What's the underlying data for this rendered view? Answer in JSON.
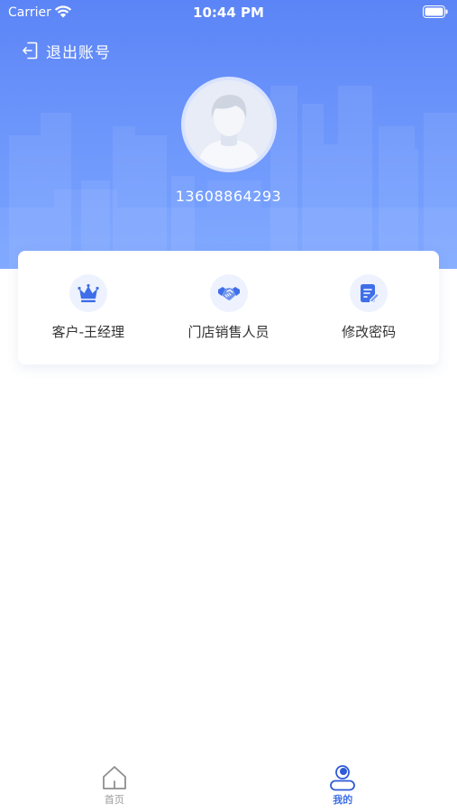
{
  "status_bar": {
    "carrier": "Carrier",
    "time": "10:44 PM"
  },
  "header": {
    "logout_label": "退出账号"
  },
  "profile": {
    "phone": "13608864293"
  },
  "menu": [
    {
      "label": "客户-王经理",
      "icon": "crown-icon"
    },
    {
      "label": "门店销售人员",
      "icon": "handshake-icon"
    },
    {
      "label": "修改密码",
      "icon": "edit-document-icon"
    }
  ],
  "tabbar": [
    {
      "label": "首页",
      "icon": "home-icon",
      "active": false
    },
    {
      "label": "我的",
      "icon": "user-icon",
      "active": true
    }
  ],
  "colors": {
    "header_top": "#5b84f6",
    "header_bottom": "#7aa5ff",
    "accent": "#3f6fe8",
    "icon_bg": "#edf2fe",
    "text": "#333333",
    "tab_inactive": "#9a9a9a"
  }
}
